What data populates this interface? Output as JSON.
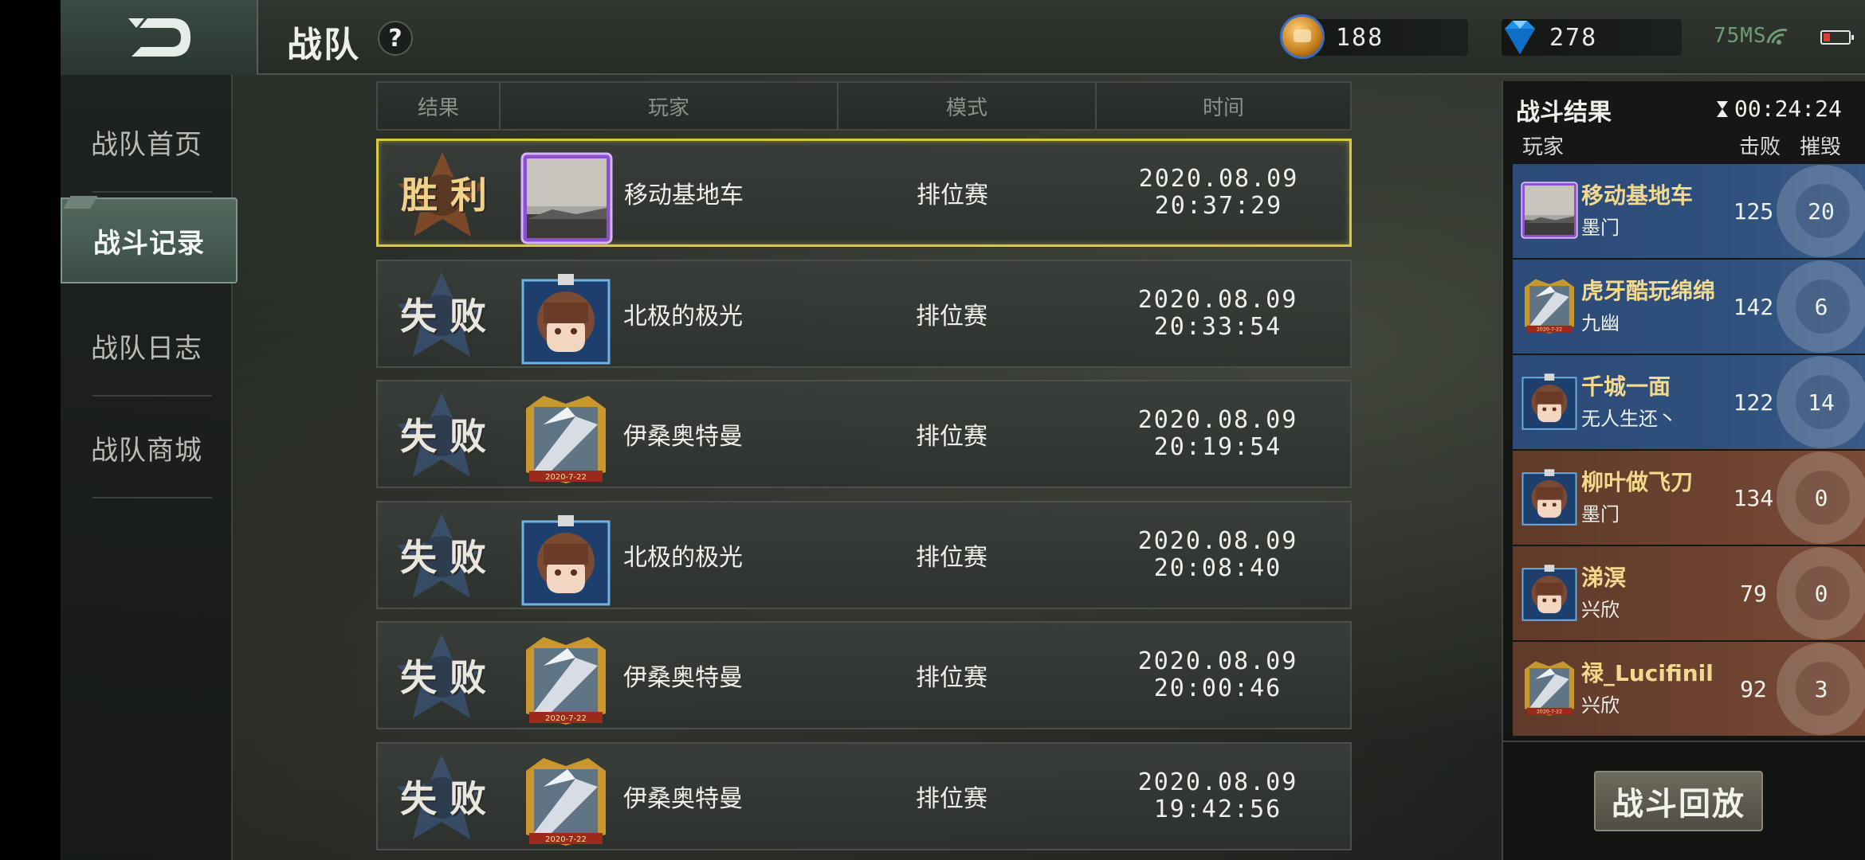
{
  "header": {
    "title": "战队",
    "help": "?",
    "gold": "188",
    "diamonds": "278",
    "ping": "75MS"
  },
  "nav": [
    {
      "label": "战队首页",
      "active": false
    },
    {
      "label": "战斗记录",
      "active": true
    },
    {
      "label": "战队日志",
      "active": false
    },
    {
      "label": "战队商城",
      "active": false
    }
  ],
  "table": {
    "columns": [
      "结果",
      "玩家",
      "模式",
      "时间"
    ],
    "rows": [
      {
        "result": "胜利",
        "player": "移动基地车",
        "mode": "排位赛",
        "date": "2020.08.09",
        "time": "20:37:29",
        "avatar": "photo-sky",
        "selected": true
      },
      {
        "result": "失败",
        "player": "北极的极光",
        "mode": "排位赛",
        "date": "2020.08.09",
        "time": "20:33:54",
        "avatar": "anime-girl",
        "selected": false
      },
      {
        "result": "失败",
        "player": "伊桑奥特曼",
        "mode": "排位赛",
        "date": "2020.08.09",
        "time": "20:19:54",
        "avatar": "gold-frame-mech",
        "selected": false
      },
      {
        "result": "失败",
        "player": "北极的极光",
        "mode": "排位赛",
        "date": "2020.08.09",
        "time": "20:08:40",
        "avatar": "anime-girl",
        "selected": false
      },
      {
        "result": "失败",
        "player": "伊桑奥特曼",
        "mode": "排位赛",
        "date": "2020.08.09",
        "time": "20:00:46",
        "avatar": "gold-frame-mech",
        "selected": false
      },
      {
        "result": "失败",
        "player": "伊桑奥特曼",
        "mode": "排位赛",
        "date": "2020.08.09",
        "time": "19:42:56",
        "avatar": "gold-frame-mech",
        "selected": false
      }
    ],
    "frame_date": "2020-7-22"
  },
  "battle_result": {
    "title": "战斗结果",
    "timer": "00:24:24",
    "headers": {
      "player": "玩家",
      "kills": "击败",
      "destroy": "摧毁"
    },
    "players": [
      {
        "name": "移动基地车",
        "team": "墨门",
        "kills": "125",
        "destroy": "20",
        "side": "blue"
      },
      {
        "name": "虎牙酷玩绵绵",
        "team": "九幽",
        "kills": "142",
        "destroy": "6",
        "side": "blue"
      },
      {
        "name": "千城一面",
        "team": "无人生还丶",
        "kills": "122",
        "destroy": "14",
        "side": "blue"
      },
      {
        "name": "柳叶做飞刀",
        "team": "墨门",
        "kills": "134",
        "destroy": "0",
        "side": "red"
      },
      {
        "name": "涕溟",
        "team": "兴欣",
        "kills": "79",
        "destroy": "0",
        "side": "red"
      },
      {
        "name": "禄_Lucifinil",
        "team": "兴欣",
        "kills": "92",
        "destroy": "3",
        "side": "red"
      }
    ],
    "replay_label": "战斗回放"
  },
  "colors": {
    "selected_border": "#d9c93f",
    "blue_team": "#2f4f7d",
    "red_team": "#6d4330",
    "name_gold": "#f3d98c"
  }
}
